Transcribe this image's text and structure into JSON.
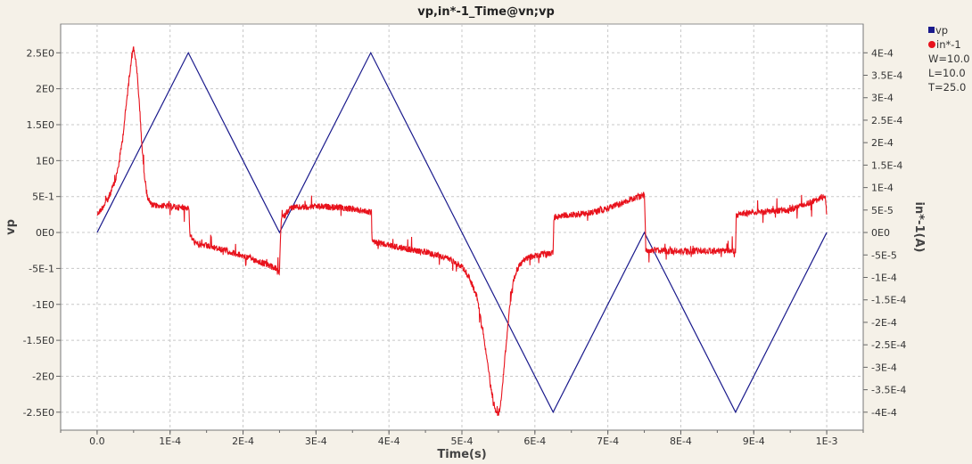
{
  "chart_data": {
    "type": "line",
    "title": "vp,in*-1_Time@vn;vp",
    "xlabel": "Time(s)",
    "ylabel_left": "vp",
    "ylabel_right": "in*-1(A)",
    "xlim": [
      -5e-05,
      0.00105
    ],
    "ylim_left": [
      -2.75,
      2.9
    ],
    "ylim_right": [
      -0.00044,
      0.000464
    ],
    "x_ticks": [
      0,
      0.0001,
      0.0002,
      0.0003,
      0.0004,
      0.0005,
      0.0006,
      0.0007,
      0.0008,
      0.0009,
      0.001
    ],
    "x_tick_labels": [
      "0.0",
      "1E-4",
      "2E-4",
      "3E-4",
      "4E-4",
      "5E-4",
      "6E-4",
      "7E-4",
      "8E-4",
      "9E-4",
      "1E-3"
    ],
    "y_left_ticks": [
      2.5,
      2,
      1.5,
      1,
      0.5,
      0,
      -0.5,
      -1,
      -1.5,
      -2,
      -2.5
    ],
    "y_left_tick_labels": [
      "2.5E0",
      "2E0",
      "1.5E0",
      "1E0",
      "5E-1",
      "0E0",
      "-5E-1",
      "-1E0",
      "-1.5E0",
      "-2E0",
      "-2.5E0"
    ],
    "y_right_ticks": [
      0.0004,
      0.00035,
      0.0003,
      0.00025,
      0.0002,
      0.00015,
      0.0001,
      5e-05,
      0,
      -5e-05,
      -0.0001,
      -0.00015,
      -0.0002,
      -0.00025,
      -0.0003,
      -0.00035,
      -0.0004
    ],
    "y_right_tick_labels": [
      "4E-4",
      "3.5E-4",
      "3E-4",
      "2.5E-4",
      "2E-4",
      "1.5E-4",
      "1E-4",
      "5E-5",
      "0E0",
      "-5E-5",
      "-1E-4",
      "-1.5E-4",
      "-2E-4",
      "-2.5E-4",
      "-3E-4",
      "-3.5E-4",
      "-4E-4"
    ],
    "grid": true,
    "legend_position": "right",
    "series": [
      {
        "name": "vp",
        "axis": "left",
        "color": "#1a1a8c",
        "x": [
          0,
          0.000125,
          0.00025,
          0.000375,
          0.000625,
          0.00075,
          0.000875,
          0.001
        ],
        "y": [
          0,
          2.5,
          0,
          2.5,
          -2.5,
          0,
          -2.5,
          0
        ]
      },
      {
        "name": "in*-1",
        "axis": "right",
        "color": "#e8121c",
        "x": [
          0,
          5e-06,
          1.5e-05,
          2.5e-05,
          3e-05,
          3.5e-05,
          4e-05,
          4.5e-05,
          4.8e-05,
          5e-05,
          5.2e-05,
          5.5e-05,
          5.8e-05,
          6e-05,
          6.2e-05,
          6.5e-05,
          6.8e-05,
          7e-05,
          7.2e-05,
          7.5e-05,
          8.5e-05,
          0.0001,
          0.000115,
          0.000126,
          0.000127,
          0.000135,
          0.00015,
          0.00018,
          0.000215,
          0.000245,
          0.00025,
          0.000251,
          0.000252,
          0.000265,
          0.0003,
          0.00034,
          0.000375,
          0.000376,
          0.000377,
          0.00039,
          0.00042,
          0.00046,
          0.000485,
          0.0005,
          0.00051,
          0.00052,
          0.000525,
          0.00053,
          0.000535,
          0.00054,
          0.000545,
          0.000548,
          0.00055,
          0.000552,
          0.000555,
          0.00056,
          0.000565,
          0.00057,
          0.000575,
          0.00058,
          0.00059,
          0.0006,
          0.000625,
          0.000626,
          0.000627,
          0.00064,
          0.00068,
          0.00072,
          0.00075,
          0.000751,
          0.000752,
          0.00076,
          0.0008,
          0.000875,
          0.000876,
          0.00088,
          0.0009,
          0.00095,
          0.000998,
          0.001
        ],
        "y": [
          4e-05,
          5e-05,
          7.5e-05,
          0.000115,
          0.000155,
          0.00021,
          0.000285,
          0.00036,
          0.0004,
          0.00041,
          0.000395,
          0.00035,
          0.000285,
          0.00023,
          0.00018,
          0.000125,
          9e-05,
          7.5e-05,
          6.8e-05,
          6e-05,
          6e-05,
          5.8e-05,
          5.5e-05,
          5.5e-05,
          -5e-06,
          -2.5e-05,
          -3e-05,
          -4.2e-05,
          -6e-05,
          -8e-05,
          -9e-05,
          -3e-05,
          3e-05,
          5.5e-05,
          5.8e-05,
          5.5e-05,
          4.5e-05,
          4.5e-05,
          -2e-05,
          -2.5e-05,
          -3.5e-05,
          -4.8e-05,
          -6e-05,
          -7.5e-05,
          -0.0001,
          -0.00014,
          -0.00018,
          -0.00023,
          -0.00029,
          -0.00035,
          -0.00039,
          -0.0004,
          -0.000405,
          -0.00039,
          -0.00035,
          -0.00026,
          -0.00017,
          -0.000115,
          -8.5e-05,
          -7e-05,
          -5.5e-05,
          -5.2e-05,
          -4.5e-05,
          3e-05,
          3.5e-05,
          3.8e-05,
          4.5e-05,
          6.5e-05,
          8.5e-05,
          4e-05,
          -4e-05,
          -4e-05,
          -4.2e-05,
          -4e-05,
          3.5e-05,
          4e-05,
          4.5e-05,
          5e-05,
          8e-05,
          4e-05
        ]
      }
    ],
    "extra_legend_labels": [
      "W=10.0",
      "L=10.0",
      "T=25.0"
    ]
  }
}
